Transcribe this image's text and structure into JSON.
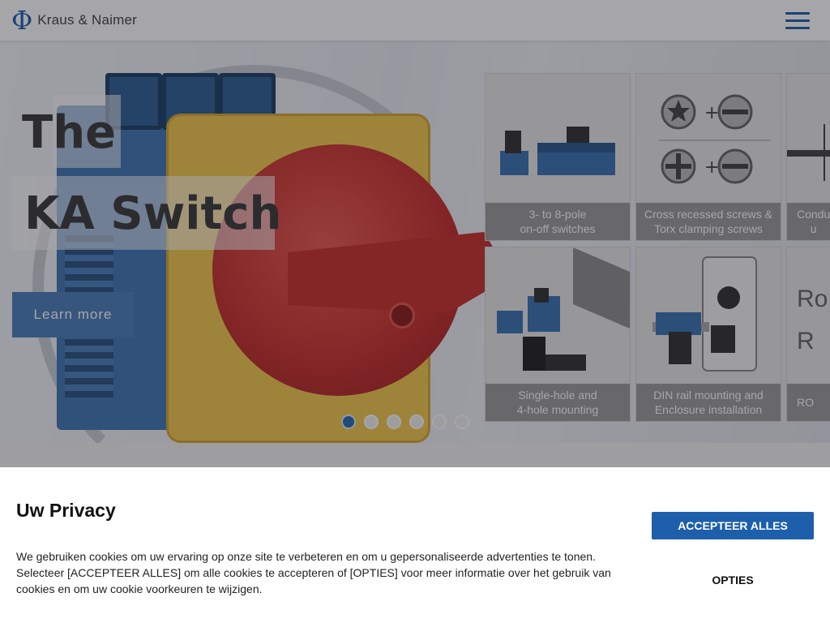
{
  "header": {
    "logo_symbol": "Φ",
    "logo_text": "Kraus & Naimer",
    "menu_icon": "hamburger-menu-icon"
  },
  "hero": {
    "title_line1": "The",
    "title_line2": "KA Switch",
    "cta_label": "Learn more",
    "features": [
      {
        "caption": "3- to 8-pole\non-off switches"
      },
      {
        "caption": "Cross recessed screws &\nTorx clamping screws"
      },
      {
        "caption": "Condu\nu"
      },
      {
        "caption": "Single-hole and\n4-hole mounting"
      },
      {
        "caption": "DIN rail mounting and\nEnclosure installation"
      },
      {
        "caption": "RO"
      }
    ],
    "partial_tile_text": "Ro\nR",
    "slide_count": 6,
    "active_slide": 1
  },
  "cookie": {
    "title": "Uw Privacy",
    "text": "We gebruiken cookies om uw ervaring op onze site te verbeteren en om u gepersonaliseerde advertenties te tonen. Selecteer [ACCEPTEER ALLES] om alle cookies te accepteren of [OPTIES] voor meer informatie over het gebruik van cookies en om uw cookie voorkeuren te wijzigen.",
    "accept_label": "ACCEPTEER ALLES",
    "options_label": "OPTIES"
  },
  "colors": {
    "brand_blue": "#1d5fab",
    "overlay": "rgba(20,20,30,0.38)"
  }
}
